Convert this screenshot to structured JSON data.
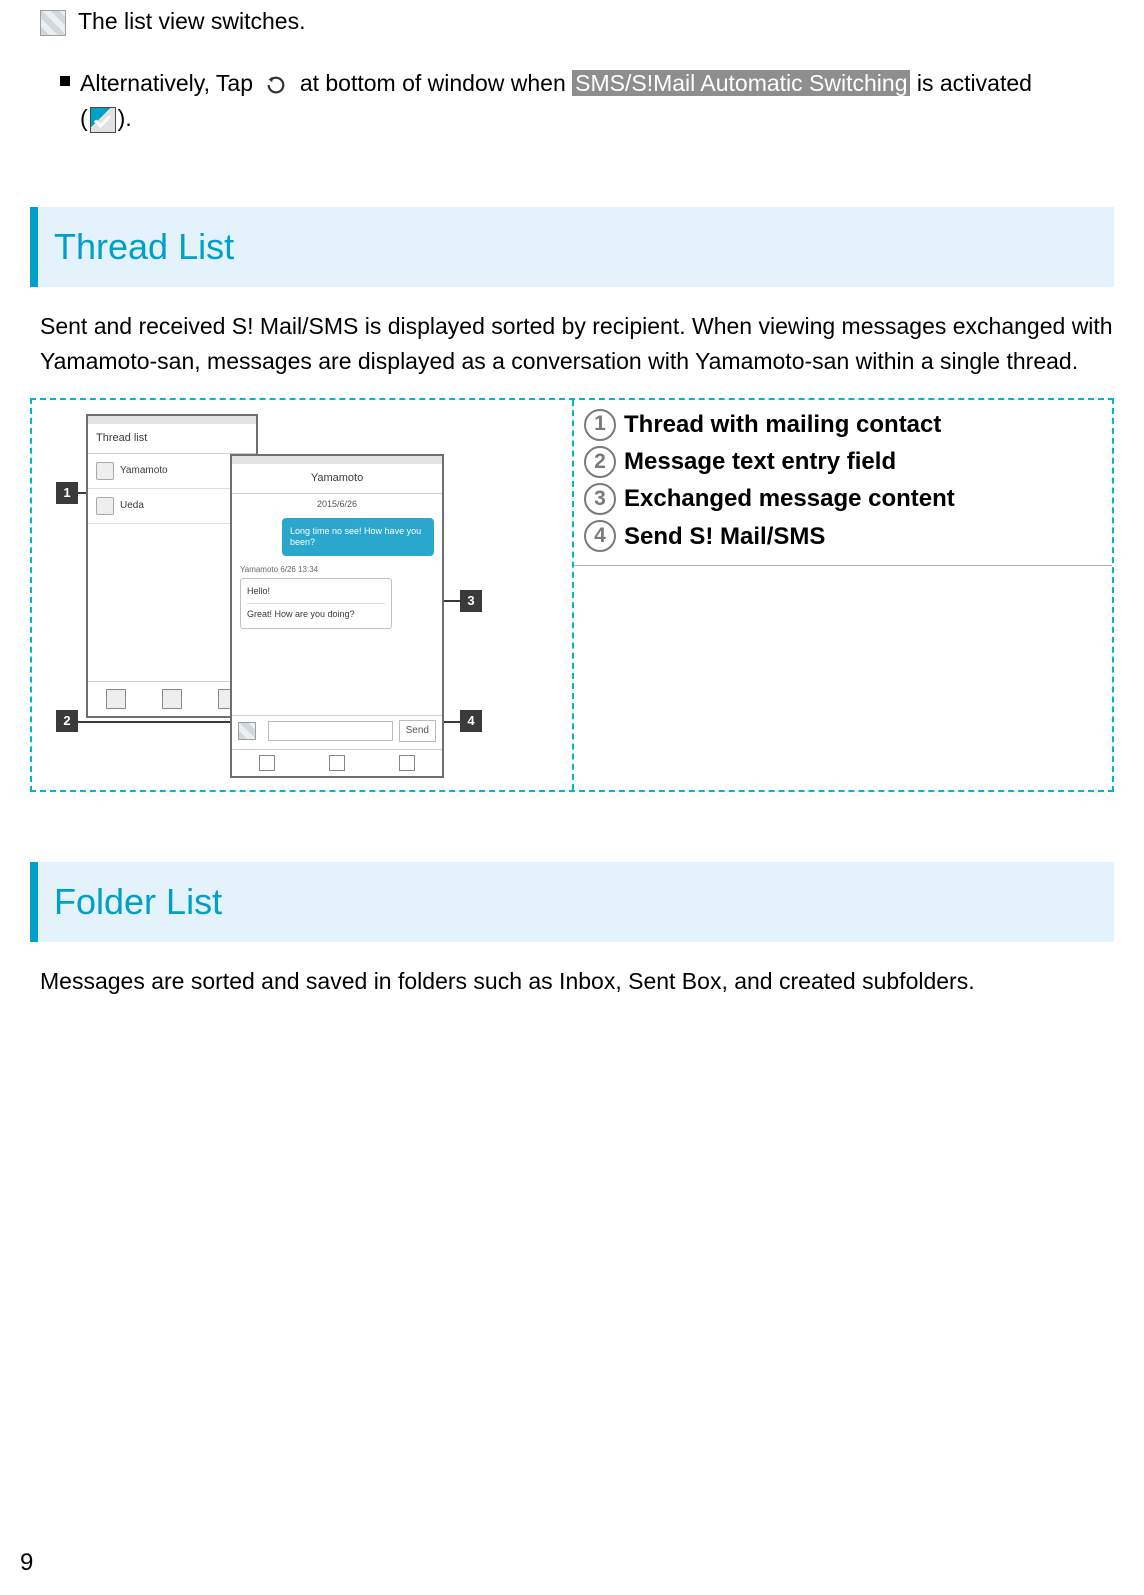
{
  "intro": {
    "switch_text": "The list view switches.",
    "alt_prefix": "Alternatively, Tap",
    "alt_mid": "at bottom of window when",
    "alt_highlight": "SMS/S!Mail Automatic Switching",
    "alt_suffix1": "is activated",
    "alt_suffix2": "(",
    "alt_suffix3": ")."
  },
  "thread_list": {
    "heading": "Thread List",
    "body": "Sent and received S! Mail/SMS is displayed sorted by recipient. When viewing messages exchanged with Yamamoto-san, messages are displayed as a conversation with Yamamoto-san within a single thread.",
    "legend": [
      {
        "n": "1",
        "text": "Thread with mailing contact"
      },
      {
        "n": "2",
        "text": "Message text entry field"
      },
      {
        "n": "3",
        "text": "Exchanged message content"
      },
      {
        "n": "4",
        "text": "Send S! Mail/SMS"
      }
    ],
    "mock": {
      "left_title": "Thread list",
      "left_items": [
        "Yamamoto",
        "Ueda"
      ],
      "right_title": "Yamamoto",
      "date": "2015/6/26",
      "out_msg": "Long time no see! How have you been?",
      "in_meta": "Yamamoto   6/26  13:34",
      "in_line1": "Hello!",
      "in_line2": "Great! How are you doing?",
      "send_label": "Send"
    }
  },
  "folder_list": {
    "heading": "Folder List",
    "body": "Messages are sorted and saved in folders such as Inbox, Sent Box, and created subfolders."
  },
  "page_number": "9"
}
